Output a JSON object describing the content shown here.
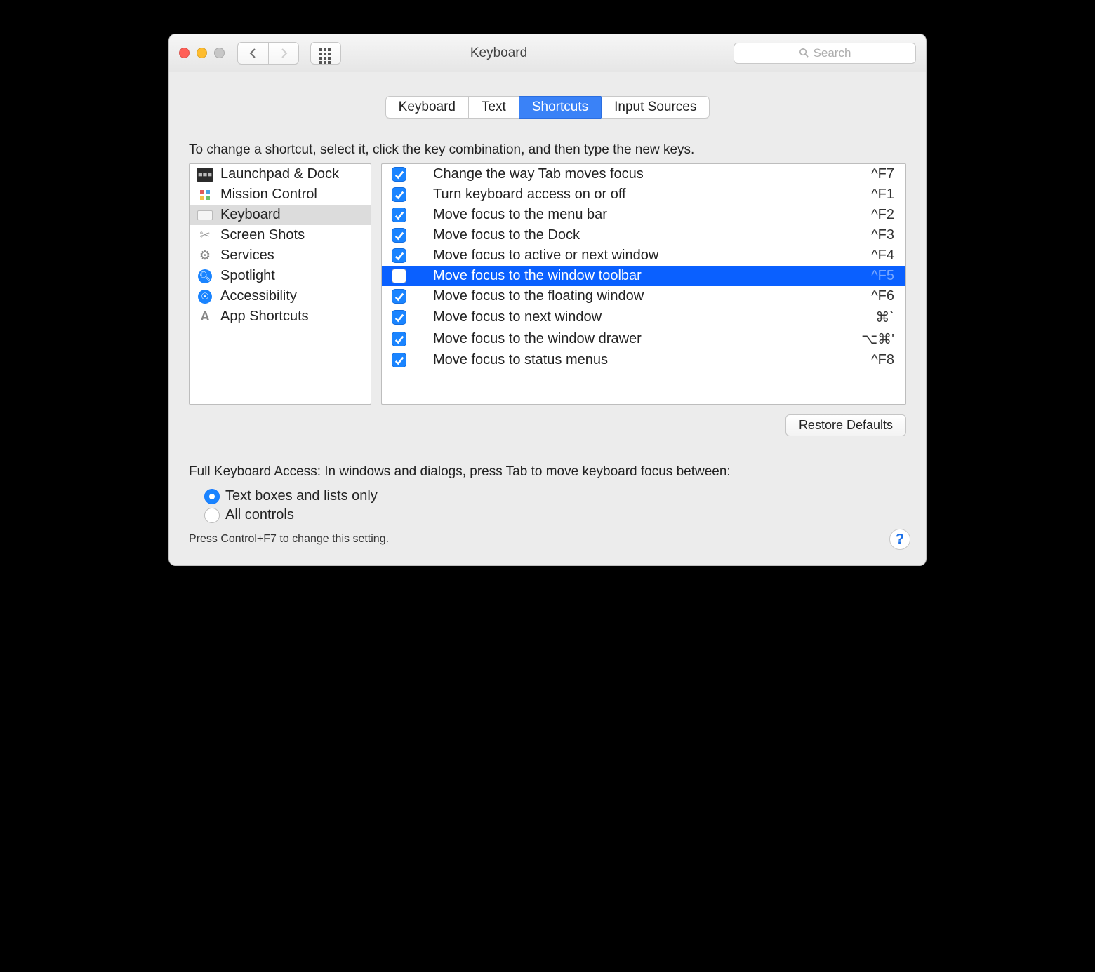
{
  "window": {
    "title": "Keyboard"
  },
  "toolbar": {
    "search_placeholder": "Search"
  },
  "tabs": [
    {
      "label": "Keyboard",
      "active": false
    },
    {
      "label": "Text",
      "active": false
    },
    {
      "label": "Shortcuts",
      "active": true
    },
    {
      "label": "Input Sources",
      "active": false
    }
  ],
  "instructions": "To change a shortcut, select it, click the key combination, and then type the new keys.",
  "categories": [
    {
      "label": "Launchpad & Dock",
      "icon": "launchpad-icon",
      "selected": false
    },
    {
      "label": "Mission Control",
      "icon": "mission-control-icon",
      "selected": false
    },
    {
      "label": "Keyboard",
      "icon": "keyboard-icon",
      "selected": true
    },
    {
      "label": "Screen Shots",
      "icon": "screenshot-icon",
      "selected": false
    },
    {
      "label": "Services",
      "icon": "gear-icon",
      "selected": false
    },
    {
      "label": "Spotlight",
      "icon": "spotlight-icon",
      "selected": false
    },
    {
      "label": "Accessibility",
      "icon": "accessibility-icon",
      "selected": false
    },
    {
      "label": "App Shortcuts",
      "icon": "app-shortcuts-icon",
      "selected": false
    }
  ],
  "shortcuts": [
    {
      "enabled": true,
      "label": "Change the way Tab moves focus",
      "keys": "^F7",
      "selected": false
    },
    {
      "enabled": true,
      "label": "Turn keyboard access on or off",
      "keys": "^F1",
      "selected": false
    },
    {
      "enabled": true,
      "label": "Move focus to the menu bar",
      "keys": "^F2",
      "selected": false
    },
    {
      "enabled": true,
      "label": "Move focus to the Dock",
      "keys": "^F3",
      "selected": false
    },
    {
      "enabled": true,
      "label": "Move focus to active or next window",
      "keys": "^F4",
      "selected": false
    },
    {
      "enabled": false,
      "label": "Move focus to the window toolbar",
      "keys": "^F5",
      "selected": true
    },
    {
      "enabled": true,
      "label": "Move focus to the floating window",
      "keys": "^F6",
      "selected": false
    },
    {
      "enabled": true,
      "label": "Move focus to next window",
      "keys": "⌘`",
      "selected": false
    },
    {
      "enabled": true,
      "label": "Move focus to the window drawer",
      "keys": "⌥⌘'",
      "selected": false
    },
    {
      "enabled": true,
      "label": "Move focus to status menus",
      "keys": "^F8",
      "selected": false
    }
  ],
  "restore_label": "Restore Defaults",
  "fka": {
    "title": "Full Keyboard Access: In windows and dialogs, press Tab to move keyboard focus between:",
    "options": [
      {
        "label": "Text boxes and lists only",
        "selected": true
      },
      {
        "label": "All controls",
        "selected": false
      }
    ],
    "hint": "Press Control+F7 to change this setting."
  },
  "help_label": "?"
}
